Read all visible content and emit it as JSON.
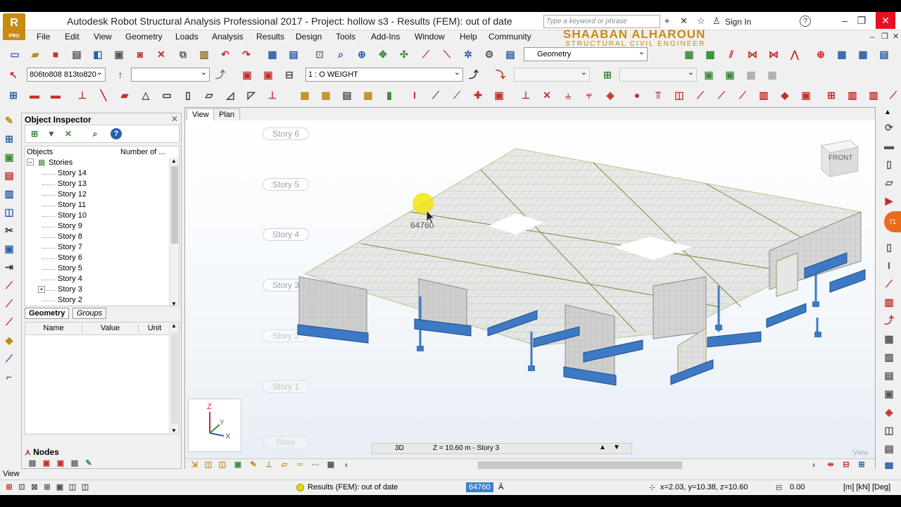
{
  "window": {
    "title": "Autodesk Robot Structural Analysis Professional 2017 - Project: hollow s3 - Results (FEM): out of date",
    "logo_text": "R",
    "logo_sub": "PRO",
    "search_placeholder": "Type a keyword or phrase",
    "sign_in": "Sign In",
    "help": "?"
  },
  "watermark": {
    "name": "SHAABAN ALHAROUN",
    "subtitle": "STRUCTURAL CIVIL ENGINEER"
  },
  "menu": [
    "File",
    "Edit",
    "View",
    "Geometry",
    "Loads",
    "Analysis",
    "Results",
    "Design",
    "Tools",
    "Add-Ins",
    "Window",
    "Help",
    "Community"
  ],
  "toolbar": {
    "selection_combo": "806to808 813to820",
    "case_combo": "1 : O WEIGHT",
    "layout_combo": "Geometry"
  },
  "inspector": {
    "title": "Object Inspector",
    "col_objects": "Objects",
    "col_number": "Number of ...",
    "root": "Stories",
    "stories": [
      "Story 14",
      "Story 13",
      "Story 12",
      "Story 11",
      "Story 10",
      "Story 9",
      "Story 8",
      "Story 7",
      "Story 6",
      "Story 5",
      "Story 4",
      "Story 3",
      "Story 2"
    ],
    "tab_geometry": "Geometry",
    "tab_groups": "Groups",
    "col_name": "Name",
    "col_value": "Value",
    "col_unit": "Unit",
    "nodes_tab": "Nodes"
  },
  "view": {
    "tab_view": "View",
    "tab_plan": "Plan",
    "story_labels": [
      "Story 6",
      "Story 5",
      "Story 4",
      "Story 3",
      "Story 2",
      "Story 1",
      "Base"
    ],
    "node_tooltip": "64760",
    "viewcube_label": "FRONT",
    "mode": "3D",
    "level": "Z = 10.60 m - Story 3",
    "corner_label": "View"
  },
  "status": {
    "view_label": "View",
    "results": "Results (FEM): out of date",
    "node_field": "64760",
    "node_field_2": "Ä",
    "coords": "x=2.03, y=10.38, z=10.60",
    "zero": "0.00",
    "units": "[m] [kN] [Deg]"
  },
  "colors": {
    "status_dot": "#e8d400",
    "accent_red": "#d8262b",
    "accent_blue": "#2a5ea8",
    "footing_blue": "#3d79c4",
    "slab_mesh": "#9aa24a",
    "wall_fill": "#d0d0d0"
  }
}
